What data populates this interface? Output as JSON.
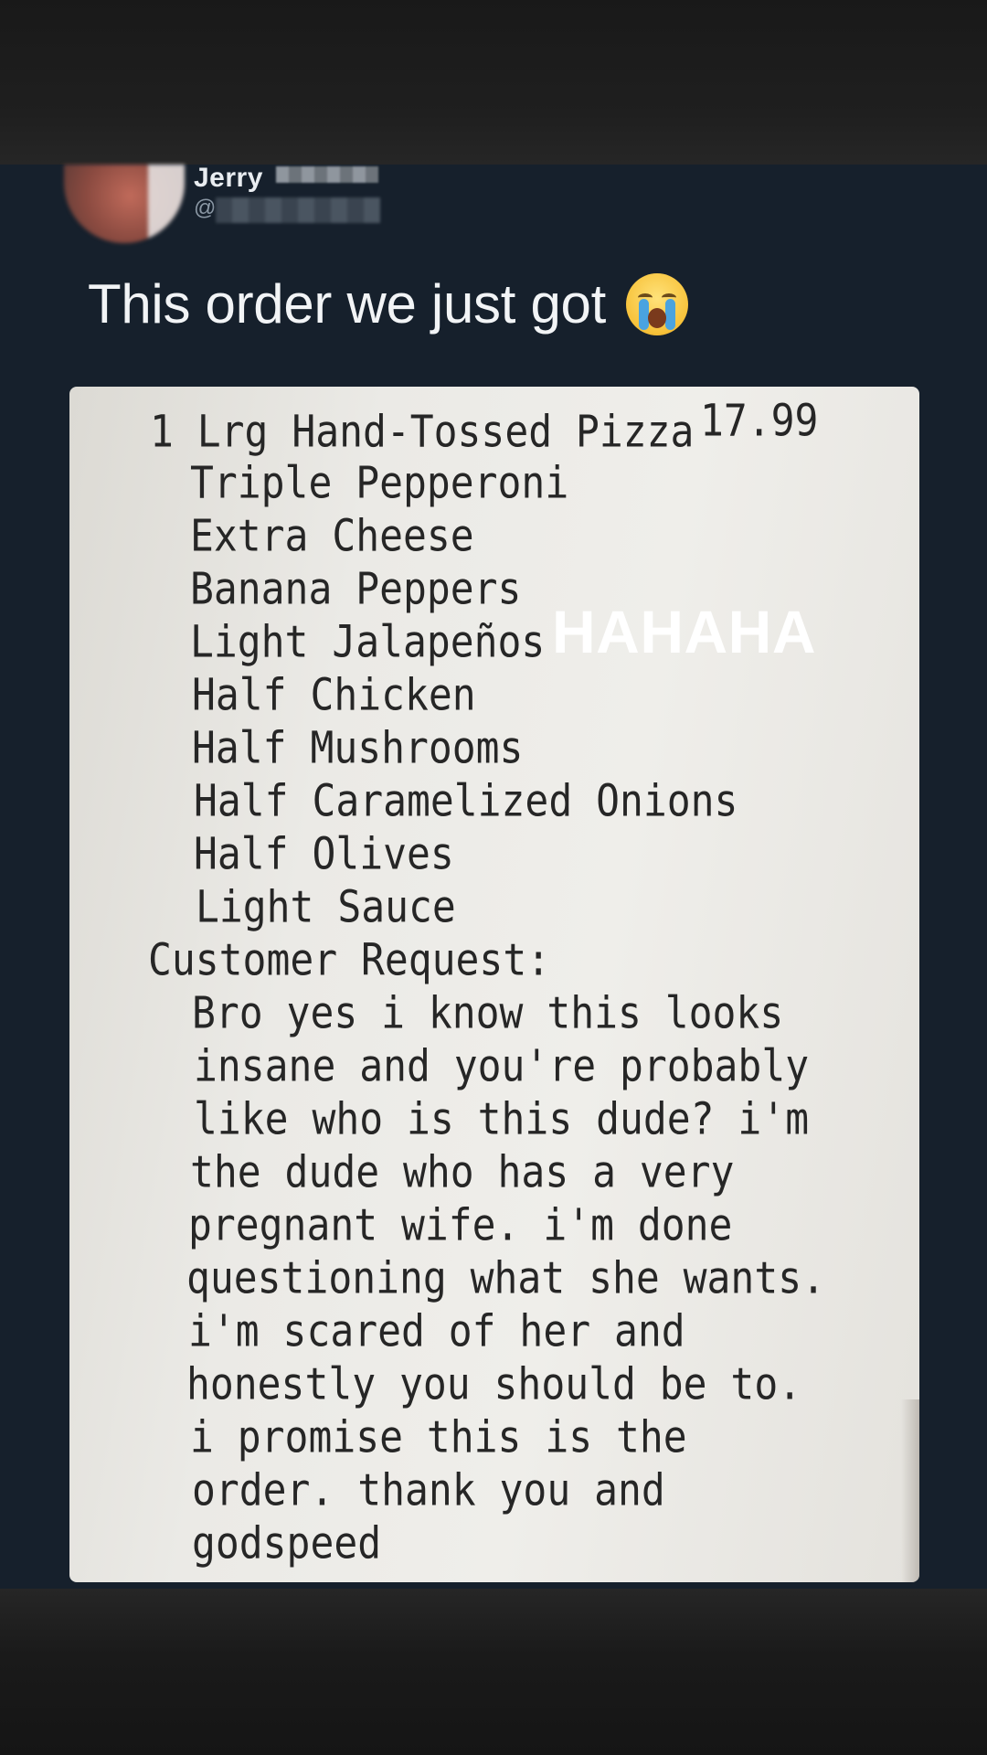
{
  "post": {
    "author_name": "Jerry",
    "author_handle": "@",
    "text": "This order we just got"
  },
  "emoji": {
    "icon": "loudly-crying-face-icon"
  },
  "receipt": {
    "item": "1 Lrg Hand-Tossed Pizza",
    "price": "17.99",
    "modifiers": [
      "Triple Pepperoni",
      "Extra Cheese",
      "Banana Peppers",
      "Light Jalapeños",
      "Half Chicken",
      "Half Mushrooms",
      "Half Caramelized Onions",
      "Half Olives",
      "Light Sauce"
    ],
    "request_label": "Customer Request:",
    "request_lines": [
      "Bro yes i know this looks",
      "insane and you're probably",
      "like who is this dude? i'm",
      "the dude who has a very",
      "pregnant wife. i'm done",
      "questioning what she wants.",
      "i'm scared of her and",
      "honestly you should be to.",
      "i promise this is the",
      "order. thank you and",
      "godspeed"
    ]
  },
  "overlay_text": "HAHAHA"
}
